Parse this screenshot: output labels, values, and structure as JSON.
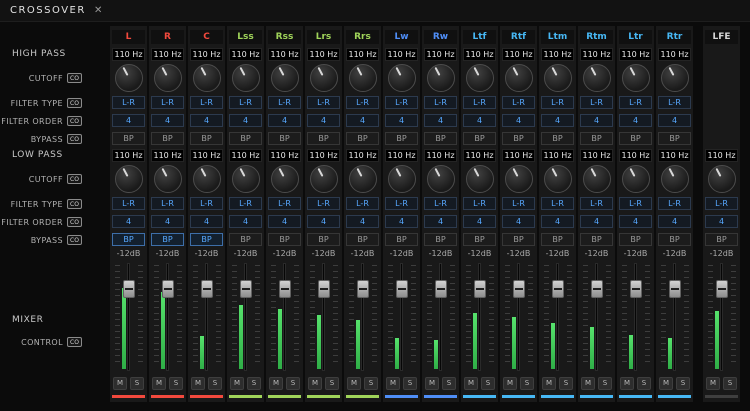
{
  "window": {
    "title": "CROSSOVER",
    "close_icon": "✕"
  },
  "sidebar": {
    "badge": "CO",
    "sections": {
      "high_pass": "HIGH PASS",
      "low_pass": "LOW PASS",
      "mixer": "MIXER"
    },
    "rows": {
      "cutoff": "CUTOFF",
      "filter_type": "FILTER TYPE",
      "filter_order": "FILTER ORDER",
      "bypass": "BYPASS",
      "control": "CONTROL"
    }
  },
  "labels": {
    "mute": "M",
    "solo": "S"
  },
  "colors": {
    "mains": "#f2493d",
    "surrounds": "#a0d45a",
    "wides": "#4f8ef7",
    "heights": "#47b8f5",
    "accent_blue": "#57a8ff",
    "meter_green": "#46d95f"
  },
  "channels": [
    {
      "name": "L",
      "label_color": "#f2493d",
      "bar_color": "#f2493d",
      "has_high_pass": true,
      "hp": {
        "freq": "110 Hz",
        "filter_type": "L-R",
        "filter_order": "4",
        "bypass": "BP",
        "bypass_active": false
      },
      "lp": {
        "freq": "110 Hz",
        "filter_type": "L-R",
        "filter_order": "4",
        "bypass": "BP",
        "bypass_active": true
      },
      "gain": "-12dB",
      "fader": 0.2,
      "meter": 0.78
    },
    {
      "name": "R",
      "label_color": "#f2493d",
      "bar_color": "#f2493d",
      "has_high_pass": true,
      "hp": {
        "freq": "110 Hz",
        "filter_type": "L-R",
        "filter_order": "4",
        "bypass": "BP",
        "bypass_active": false
      },
      "lp": {
        "freq": "110 Hz",
        "filter_type": "L-R",
        "filter_order": "4",
        "bypass": "BP",
        "bypass_active": true
      },
      "gain": "-12dB",
      "fader": 0.2,
      "meter": 0.74
    },
    {
      "name": "C",
      "label_color": "#f2493d",
      "bar_color": "#f2493d",
      "has_high_pass": true,
      "hp": {
        "freq": "110 Hz",
        "filter_type": "L-R",
        "filter_order": "4",
        "bypass": "BP",
        "bypass_active": false
      },
      "lp": {
        "freq": "110 Hz",
        "filter_type": "L-R",
        "filter_order": "4",
        "bypass": "BP",
        "bypass_active": true
      },
      "gain": "-12dB",
      "fader": 0.2,
      "meter": 0.32
    },
    {
      "name": "Lss",
      "label_color": "#a0d45a",
      "bar_color": "#a0d45a",
      "has_high_pass": true,
      "hp": {
        "freq": "110 Hz",
        "filter_type": "L-R",
        "filter_order": "4",
        "bypass": "BP",
        "bypass_active": false
      },
      "lp": {
        "freq": "110 Hz",
        "filter_type": "L-R",
        "filter_order": "4",
        "bypass": "BP",
        "bypass_active": false
      },
      "gain": "-12dB",
      "fader": 0.2,
      "meter": 0.62
    },
    {
      "name": "Rss",
      "label_color": "#a0d45a",
      "bar_color": "#a0d45a",
      "has_high_pass": true,
      "hp": {
        "freq": "110 Hz",
        "filter_type": "L-R",
        "filter_order": "4",
        "bypass": "BP",
        "bypass_active": false
      },
      "lp": {
        "freq": "110 Hz",
        "filter_type": "L-R",
        "filter_order": "4",
        "bypass": "BP",
        "bypass_active": false
      },
      "gain": "-12dB",
      "fader": 0.2,
      "meter": 0.58
    },
    {
      "name": "Lrs",
      "label_color": "#a0d45a",
      "bar_color": "#a0d45a",
      "has_high_pass": true,
      "hp": {
        "freq": "110 Hz",
        "filter_type": "L-R",
        "filter_order": "4",
        "bypass": "BP",
        "bypass_active": false
      },
      "lp": {
        "freq": "110 Hz",
        "filter_type": "L-R",
        "filter_order": "4",
        "bypass": "BP",
        "bypass_active": false
      },
      "gain": "-12dB",
      "fader": 0.2,
      "meter": 0.52
    },
    {
      "name": "Rrs",
      "label_color": "#a0d45a",
      "bar_color": "#a0d45a",
      "has_high_pass": true,
      "hp": {
        "freq": "110 Hz",
        "filter_type": "L-R",
        "filter_order": "4",
        "bypass": "BP",
        "bypass_active": false
      },
      "lp": {
        "freq": "110 Hz",
        "filter_type": "L-R",
        "filter_order": "4",
        "bypass": "BP",
        "bypass_active": false
      },
      "gain": "-12dB",
      "fader": 0.2,
      "meter": 0.47
    },
    {
      "name": "Lw",
      "label_color": "#4f8ef7",
      "bar_color": "#4f8ef7",
      "has_high_pass": true,
      "hp": {
        "freq": "110 Hz",
        "filter_type": "L-R",
        "filter_order": "4",
        "bypass": "BP",
        "bypass_active": false
      },
      "lp": {
        "freq": "110 Hz",
        "filter_type": "L-R",
        "filter_order": "4",
        "bypass": "BP",
        "bypass_active": false
      },
      "gain": "-12dB",
      "fader": 0.2,
      "meter": 0.3
    },
    {
      "name": "Rw",
      "label_color": "#4f8ef7",
      "bar_color": "#4f8ef7",
      "has_high_pass": true,
      "hp": {
        "freq": "110 Hz",
        "filter_type": "L-R",
        "filter_order": "4",
        "bypass": "BP",
        "bypass_active": false
      },
      "lp": {
        "freq": "110 Hz",
        "filter_type": "L-R",
        "filter_order": "4",
        "bypass": "BP",
        "bypass_active": false
      },
      "gain": "-12dB",
      "fader": 0.2,
      "meter": 0.28
    },
    {
      "name": "Ltf",
      "label_color": "#47b8f5",
      "bar_color": "#47b8f5",
      "has_high_pass": true,
      "hp": {
        "freq": "110 Hz",
        "filter_type": "L-R",
        "filter_order": "4",
        "bypass": "BP",
        "bypass_active": false
      },
      "lp": {
        "freq": "110 Hz",
        "filter_type": "L-R",
        "filter_order": "4",
        "bypass": "BP",
        "bypass_active": false
      },
      "gain": "-12dB",
      "fader": 0.2,
      "meter": 0.54
    },
    {
      "name": "Rtf",
      "label_color": "#47b8f5",
      "bar_color": "#47b8f5",
      "has_high_pass": true,
      "hp": {
        "freq": "110 Hz",
        "filter_type": "L-R",
        "filter_order": "4",
        "bypass": "BP",
        "bypass_active": false
      },
      "lp": {
        "freq": "110 Hz",
        "filter_type": "L-R",
        "filter_order": "4",
        "bypass": "BP",
        "bypass_active": false
      },
      "gain": "-12dB",
      "fader": 0.2,
      "meter": 0.5
    },
    {
      "name": "Ltm",
      "label_color": "#47b8f5",
      "bar_color": "#47b8f5",
      "has_high_pass": true,
      "hp": {
        "freq": "110 Hz",
        "filter_type": "L-R",
        "filter_order": "4",
        "bypass": "BP",
        "bypass_active": false
      },
      "lp": {
        "freq": "110 Hz",
        "filter_type": "L-R",
        "filter_order": "4",
        "bypass": "BP",
        "bypass_active": false
      },
      "gain": "-12dB",
      "fader": 0.2,
      "meter": 0.44
    },
    {
      "name": "Rtm",
      "label_color": "#47b8f5",
      "bar_color": "#47b8f5",
      "has_high_pass": true,
      "hp": {
        "freq": "110 Hz",
        "filter_type": "L-R",
        "filter_order": "4",
        "bypass": "BP",
        "bypass_active": false
      },
      "lp": {
        "freq": "110 Hz",
        "filter_type": "L-R",
        "filter_order": "4",
        "bypass": "BP",
        "bypass_active": false
      },
      "gain": "-12dB",
      "fader": 0.2,
      "meter": 0.4
    },
    {
      "name": "Ltr",
      "label_color": "#47b8f5",
      "bar_color": "#47b8f5",
      "has_high_pass": true,
      "hp": {
        "freq": "110 Hz",
        "filter_type": "L-R",
        "filter_order": "4",
        "bypass": "BP",
        "bypass_active": false
      },
      "lp": {
        "freq": "110 Hz",
        "filter_type": "L-R",
        "filter_order": "4",
        "bypass": "BP",
        "bypass_active": false
      },
      "gain": "-12dB",
      "fader": 0.2,
      "meter": 0.33
    },
    {
      "name": "Rtr",
      "label_color": "#47b8f5",
      "bar_color": "#47b8f5",
      "has_high_pass": true,
      "hp": {
        "freq": "110 Hz",
        "filter_type": "L-R",
        "filter_order": "4",
        "bypass": "BP",
        "bypass_active": false
      },
      "lp": {
        "freq": "110 Hz",
        "filter_type": "L-R",
        "filter_order": "4",
        "bypass": "BP",
        "bypass_active": false
      },
      "gain": "-12dB",
      "fader": 0.2,
      "meter": 0.3
    },
    {
      "name": "LFE",
      "label_color": "#d6d6d6",
      "bar_color": "#3f3f3f",
      "has_high_pass": false,
      "lp": {
        "freq": "110 Hz",
        "filter_type": "L-R",
        "filter_order": "4",
        "bypass": "BP",
        "bypass_active": false
      },
      "gain": "-12dB",
      "fader": 0.2,
      "meter": 0.56
    }
  ]
}
